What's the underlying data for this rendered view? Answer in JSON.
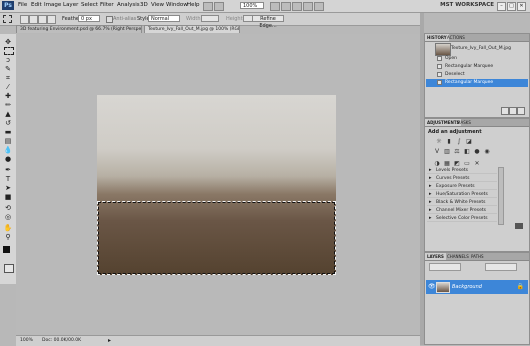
{
  "app": {
    "logo": "Ps",
    "workspace": "MST WORKSPACE",
    "zoom": "100%"
  },
  "menu": [
    "File",
    "Edit",
    "Image",
    "Layer",
    "Select",
    "Filter",
    "Analysis",
    "3D",
    "View",
    "Window",
    "Help"
  ],
  "window_controls": [
    "–",
    "□",
    "✕"
  ],
  "options": {
    "feather_label": "Feather:",
    "feather_value": "0 px",
    "antialias_label": "Anti-alias",
    "style_label": "Style:",
    "style_value": "Normal",
    "width_label": "Width:",
    "height_label": "Height:",
    "refine_edge": "Refine Edge..."
  },
  "tabs": [
    {
      "label": "3D featuring Environment.psd @ 66.7% (Right Perspective, RGB/8)",
      "active": false
    },
    {
      "label": "Texture_Ivy_Fall_Out_M.jpg @ 100% (RGB/8)",
      "active": true
    }
  ],
  "toolbox": {
    "tools": [
      "move-tool",
      "marquee-tool",
      "lasso-tool",
      "quick-select-tool",
      "crop-tool",
      "eyedropper-tool",
      "healing-tool",
      "brush-tool",
      "clone-stamp-tool",
      "history-brush-tool",
      "eraser-tool",
      "gradient-tool",
      "blur-tool",
      "dodge-tool",
      "pen-tool",
      "type-tool",
      "path-select-tool",
      "shape-tool",
      "3d-rotate-tool",
      "3d-orbit-tool",
      "hand-tool",
      "zoom-tool"
    ]
  },
  "status": {
    "zoom": "100%",
    "doc_size": "Doc: 00.0K/00.0K"
  },
  "history_panel": {
    "tabs": [
      "HISTORY",
      "ACTIONS"
    ],
    "snapshot": "Texture_Ivy_Fall_Out_M.jpg",
    "states": [
      {
        "label": "Open",
        "selected": false
      },
      {
        "label": "Rectangular Marquee",
        "selected": false
      },
      {
        "label": "Deselect",
        "selected": false
      },
      {
        "label": "Rectangular Marquee",
        "selected": true
      }
    ]
  },
  "adjustments_panel": {
    "tabs": [
      "ADJUSTMENTS",
      "MASKS"
    ],
    "heading": "Add an adjustment",
    "presets": [
      "Levels Presets",
      "Curves Presets",
      "Exposure Presets",
      "Hue/Saturation Presets",
      "Black & White Presets",
      "Channel Mixer Presets",
      "Selective Color Presets"
    ]
  },
  "layers_panel": {
    "tabs": [
      "LAYERS",
      "CHANNELS",
      "PATHS"
    ],
    "layers": [
      {
        "name": "Background",
        "selected": true
      }
    ]
  },
  "colors": {
    "selection_blue": "#3d86d8",
    "panel_gray": "#cfcfcf"
  }
}
